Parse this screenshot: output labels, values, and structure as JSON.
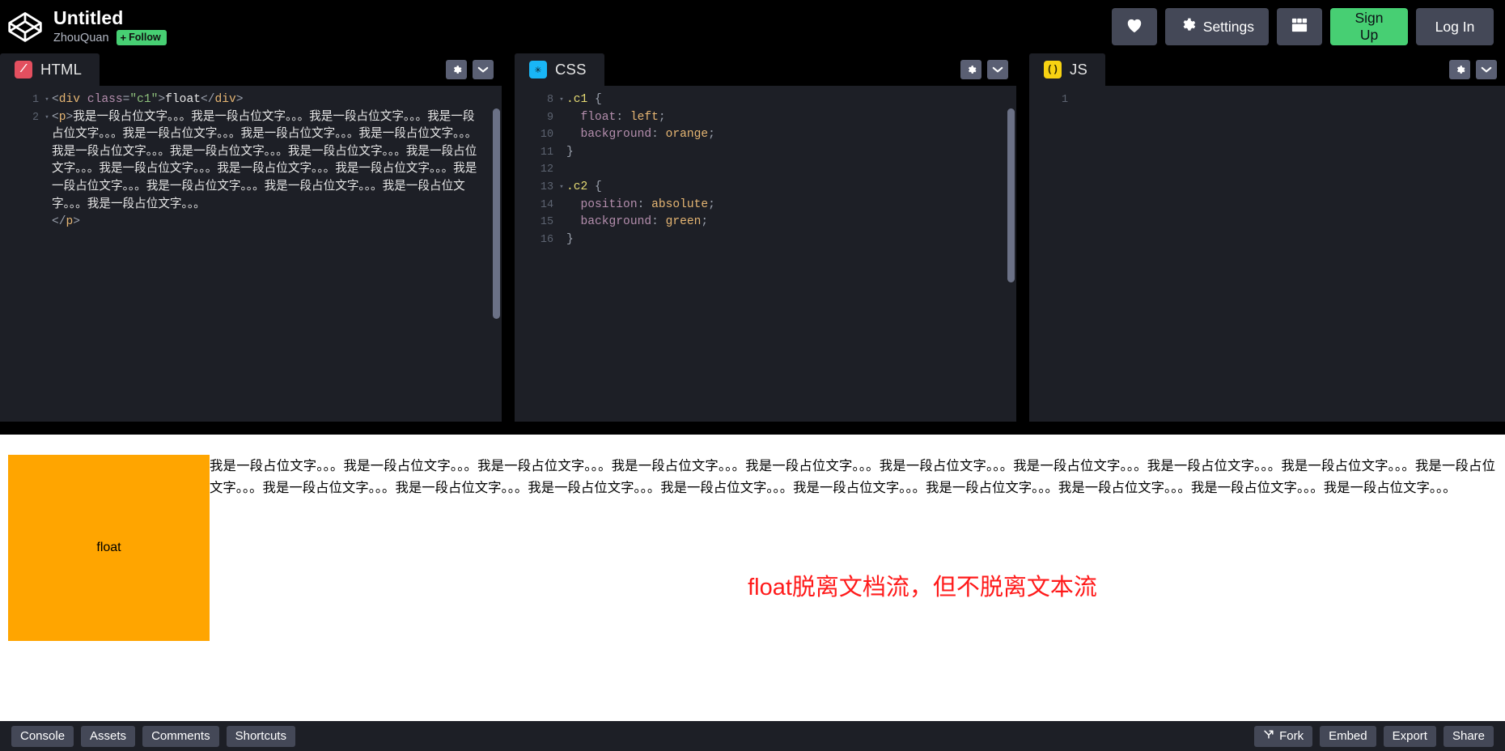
{
  "header": {
    "logo_icon": "codepen-logo-icon",
    "pen_title": "Untitled",
    "author": "ZhouQuan",
    "follow_plus": "+",
    "follow_label": "Follow",
    "like_icon": "heart-icon",
    "settings_icon": "gear-icon",
    "settings_label": "Settings",
    "layout_icon": "layout-grid-icon",
    "signup_label": "Sign Up",
    "login_label": "Log In"
  },
  "editors": [
    {
      "name": "HTML",
      "icon": "html-logo-icon",
      "settings_icon": "gear-icon",
      "collapse_icon": "chevron-down-icon",
      "lines": [
        {
          "num": "1",
          "fold": "▾",
          "tokens": [
            {
              "c": "t-punc",
              "t": "<"
            },
            {
              "c": "t-tag",
              "t": "div"
            },
            {
              "c": "t-plain",
              "t": " "
            },
            {
              "c": "t-attr",
              "t": "class"
            },
            {
              "c": "t-punc",
              "t": "="
            },
            {
              "c": "t-str",
              "t": "\"c1\""
            },
            {
              "c": "t-punc",
              "t": ">"
            },
            {
              "c": "t-plain",
              "t": "float"
            },
            {
              "c": "t-punc",
              "t": "</"
            },
            {
              "c": "t-tag",
              "t": "div"
            },
            {
              "c": "t-punc",
              "t": ">"
            }
          ]
        },
        {
          "num": "2",
          "fold": "▾",
          "tokens": [
            {
              "c": "t-punc",
              "t": "<"
            },
            {
              "c": "t-tag",
              "t": "p"
            },
            {
              "c": "t-punc",
              "t": ">"
            },
            {
              "c": "t-plain",
              "t": "我是一段占位文字。。。我是一段占位文字。。。我是一段占位文字。。。我是一段占位文字。。。我是一段占位文字。。。我是一段占位文字。。。我是一段占位文字。。。我是一段占位文字。。。我是一段占位文字。。。我是一段占位文字。。。我是一段占位文字。。。我是一段占位文字。。。我是一段占位文字。。。我是一段占位文字。。。我是一段占位文字。。。我是一段占位文字。。。我是一段占位文字。。。我是一段占位文字。。。我是一段占位文字。。。"
            }
          ]
        },
        {
          "num": "",
          "fold": "",
          "tokens": [
            {
              "c": "t-punc",
              "t": "</"
            },
            {
              "c": "t-tag",
              "t": "p"
            },
            {
              "c": "t-punc",
              "t": ">"
            }
          ]
        }
      ]
    },
    {
      "name": "CSS",
      "icon": "css-logo-icon",
      "settings_icon": "gear-icon",
      "collapse_icon": "chevron-down-icon",
      "lines": [
        {
          "num": "8",
          "fold": "▾",
          "tokens": [
            {
              "c": "t-sel",
              "t": ".c1"
            },
            {
              "c": "t-plain",
              "t": " "
            },
            {
              "c": "t-brace",
              "t": "{"
            }
          ]
        },
        {
          "num": "9",
          "fold": "",
          "tokens": [
            {
              "c": "t-plain",
              "t": "  "
            },
            {
              "c": "t-prop",
              "t": "float"
            },
            {
              "c": "t-punc",
              "t": ": "
            },
            {
              "c": "t-val",
              "t": "left"
            },
            {
              "c": "t-punc",
              "t": ";"
            }
          ]
        },
        {
          "num": "10",
          "fold": "",
          "tokens": [
            {
              "c": "t-plain",
              "t": "  "
            },
            {
              "c": "t-prop",
              "t": "background"
            },
            {
              "c": "t-punc",
              "t": ": "
            },
            {
              "c": "t-val",
              "t": "orange"
            },
            {
              "c": "t-punc",
              "t": ";"
            }
          ]
        },
        {
          "num": "11",
          "fold": "",
          "tokens": [
            {
              "c": "t-brace",
              "t": "}"
            }
          ]
        },
        {
          "num": "12",
          "fold": "",
          "tokens": [
            {
              "c": "t-plain",
              "t": ""
            }
          ]
        },
        {
          "num": "13",
          "fold": "▾",
          "tokens": [
            {
              "c": "t-sel",
              "t": ".c2"
            },
            {
              "c": "t-plain",
              "t": " "
            },
            {
              "c": "t-brace",
              "t": "{"
            }
          ]
        },
        {
          "num": "14",
          "fold": "",
          "tokens": [
            {
              "c": "t-plain",
              "t": "  "
            },
            {
              "c": "t-prop",
              "t": "position"
            },
            {
              "c": "t-punc",
              "t": ": "
            },
            {
              "c": "t-val",
              "t": "absolute"
            },
            {
              "c": "t-punc",
              "t": ";"
            }
          ]
        },
        {
          "num": "15",
          "fold": "",
          "tokens": [
            {
              "c": "t-plain",
              "t": "  "
            },
            {
              "c": "t-prop",
              "t": "background"
            },
            {
              "c": "t-punc",
              "t": ": "
            },
            {
              "c": "t-val",
              "t": "green"
            },
            {
              "c": "t-punc",
              "t": ";"
            }
          ]
        },
        {
          "num": "16",
          "fold": "",
          "tokens": [
            {
              "c": "t-brace",
              "t": "}"
            }
          ]
        }
      ]
    },
    {
      "name": "JS",
      "icon": "js-logo-icon",
      "settings_icon": "gear-icon",
      "collapse_icon": "chevron-down-icon",
      "lines": [
        {
          "num": "1",
          "fold": "",
          "tokens": [
            {
              "c": "t-plain",
              "t": ""
            }
          ]
        }
      ]
    }
  ],
  "preview": {
    "float_box_label": "float",
    "float_box_color": "#FF9E0C",
    "flow_text": "我是一段占位文字。。。我是一段占位文字。。。我是一段占位文字。。。我是一段占位文字。。。我是一段占位文字。。。我是一段占位文字。。。我是一段占位文字。。。我是一段占位文字。。。我是一段占位文字。。。我是一段占位文字。。。我是一段占位文字。。。我是一段占位文字。。。我是一段占位文字。。。我是一段占位文字。。。我是一段占位文字。。。我是一段占位文字。。。我是一段占位文字。。。我是一段占位文字。。。我是一段占位文字。。。",
    "note": "float脱离文档流，但不脱离文本流",
    "note_color": "#FF1A1A"
  },
  "footer": {
    "left_buttons": [
      {
        "label": "Console"
      },
      {
        "label": "Assets"
      },
      {
        "label": "Comments"
      },
      {
        "label": "Shortcuts"
      }
    ],
    "right_buttons": [
      {
        "label": "Fork",
        "icon": "fork-icon"
      },
      {
        "label": "Embed",
        "icon": ""
      },
      {
        "label": "Export",
        "icon": ""
      },
      {
        "label": "Share",
        "icon": ""
      }
    ]
  }
}
